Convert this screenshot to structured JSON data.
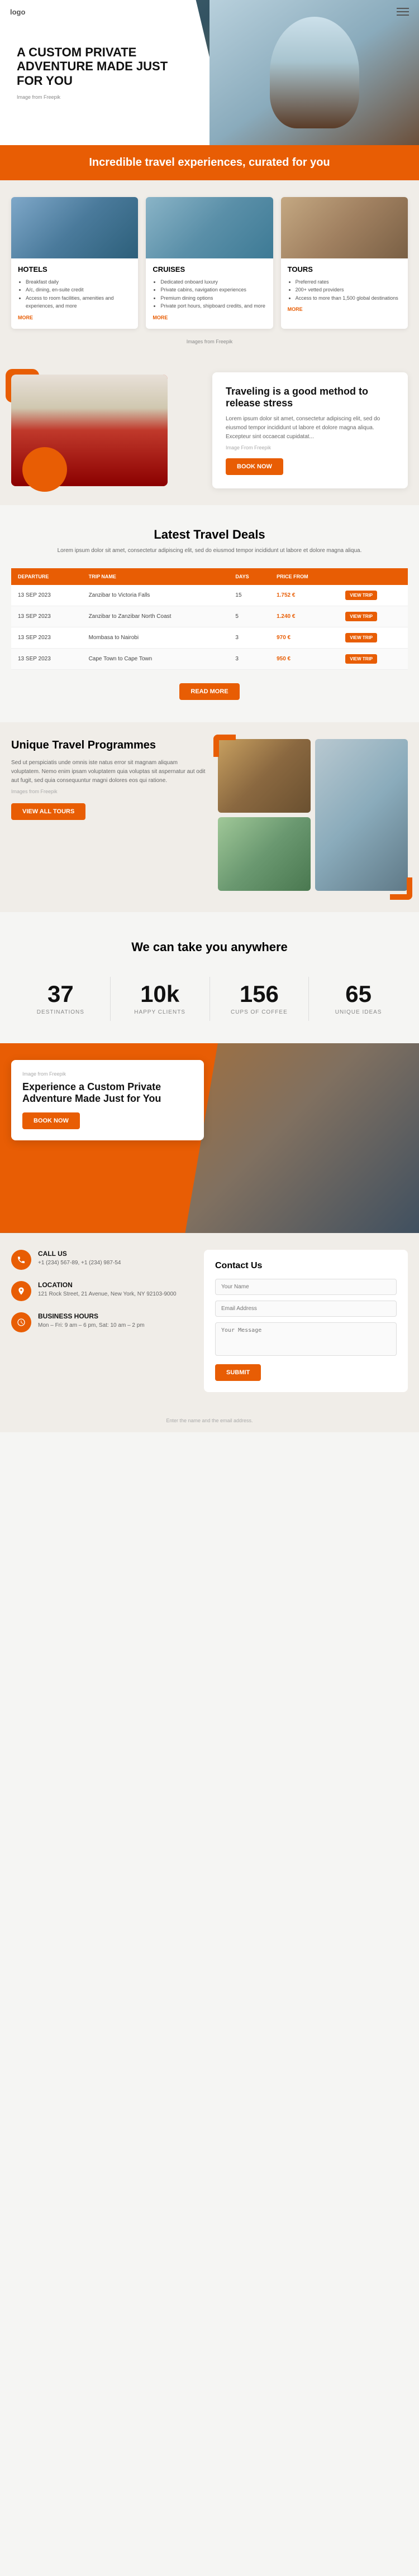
{
  "header": {
    "logo": "logo",
    "title": "A CUSTOM PRIVATE ADVENTURE MADE JUST FOR YOU",
    "image_credit": "Image from Freepik"
  },
  "tagline": {
    "text": "Incredible travel experiences, curated for you"
  },
  "cards": {
    "source": "Images from Freepik",
    "items": [
      {
        "id": "hotels",
        "title": "HOTELS",
        "features": [
          "Breakfast daily",
          "A/c, dining, en-suite credit",
          "Access to room facilities, amenities and experiences, and more"
        ],
        "more_label": "MORE"
      },
      {
        "id": "cruises",
        "title": "CRUISES",
        "features": [
          "Dedicated onboard luxury",
          "Private cabins, navigation experiences",
          "Premium dining options",
          "Private port hours, shipboard credits, and more"
        ],
        "more_label": "MORE"
      },
      {
        "id": "tours",
        "title": "TOURS",
        "features": [
          "Preferred rates",
          "200+ vetted providers",
          "Access to more than 1,500 global destinations"
        ],
        "more_label": "MORE"
      }
    ]
  },
  "stress": {
    "title": "Traveling is a good method to release stress",
    "body": "Lorem ipsum dolor sit amet, consectetur adipiscing elit, sed do eiusmod tempor incididunt ut labore et dolore magna aliqua. Excepteur sint occaecat cupidatat...",
    "image_credit": "Image From Freepik",
    "btn_label": "BOOK NOW"
  },
  "deals": {
    "title": "Latest Travel Deals",
    "subtitle": "Lorem ipsum dolor sit amet, consectetur adipiscing elit, sed do eiusmod tempor incididunt ut labore et dolore magna aliqua.",
    "columns": [
      "DEPARTURE",
      "TRIP NAME",
      "DAYS",
      "PRICE FROM",
      ""
    ],
    "rows": [
      {
        "date": "13 SEP 2023",
        "trip": "Zanzibar to Victoria Falls",
        "days": "15",
        "price": "1.752 €",
        "btn": "VIEW TRIP"
      },
      {
        "date": "13 SEP 2023",
        "trip": "Zanzibar to Zanzibar North Coast",
        "days": "5",
        "price": "1.240 €",
        "btn": "VIEW TRIP"
      },
      {
        "date": "13 SEP 2023",
        "trip": "Mombasa to Nairobi",
        "days": "3",
        "price": "970 €",
        "btn": "VIEW TRIP"
      },
      {
        "date": "13 SEP 2023",
        "trip": "Cape Town to Cape Town",
        "days": "3",
        "price": "950 €",
        "btn": "VIEW TRIP"
      }
    ],
    "more_btn": "READ MORE"
  },
  "programmes": {
    "title": "Unique Travel Programmes",
    "body": "Sed ut perspiciatis unde omnis iste natus error sit magnam aliquam voluptatem. Nemo enim ipsam voluptatem quia voluptas sit aspernatur aut odit aut fugit, sed quia consequuntur magni dolores eos qui ratione.",
    "image_credit": "Images from Freepik",
    "btn_label": "VIEW ALL TOURS"
  },
  "stats": {
    "title": "We can take you anywhere",
    "items": [
      {
        "number": "37",
        "label": "DESTINATIONS"
      },
      {
        "number": "10k",
        "label": "HAPPY CLIENTS"
      },
      {
        "number": "156",
        "label": "CUPS OF COFFEE"
      },
      {
        "number": "65",
        "label": "UNIQUE IDEAS"
      }
    ]
  },
  "adventure": {
    "image_credit": "Image from Freepik",
    "title": "Experience a Custom Private Adventure Made Just for You",
    "btn_label": "BOOK NOW"
  },
  "contact": {
    "left": {
      "call": {
        "label": "CALL US",
        "value": "+1 (234) 567-89, +1 (234) 987-54"
      },
      "location": {
        "label": "LOCATION",
        "value": "121 Rock Street, 21 Avenue, New York, NY 92103-9000"
      },
      "hours": {
        "label": "BUSINESS HOURS",
        "value": "Mon – Fri: 9 am – 6 pm, Sat: 10 am – 2 pm"
      }
    },
    "right": {
      "title": "Contact Us",
      "fields": [
        {
          "id": "name",
          "placeholder": "Your Name"
        },
        {
          "id": "email",
          "placeholder": "Email Address"
        },
        {
          "id": "message",
          "placeholder": "Your Message",
          "type": "textarea"
        }
      ],
      "submit_label": "SUBMIT"
    }
  },
  "footer": {
    "note": "Enter the name and the email address."
  }
}
